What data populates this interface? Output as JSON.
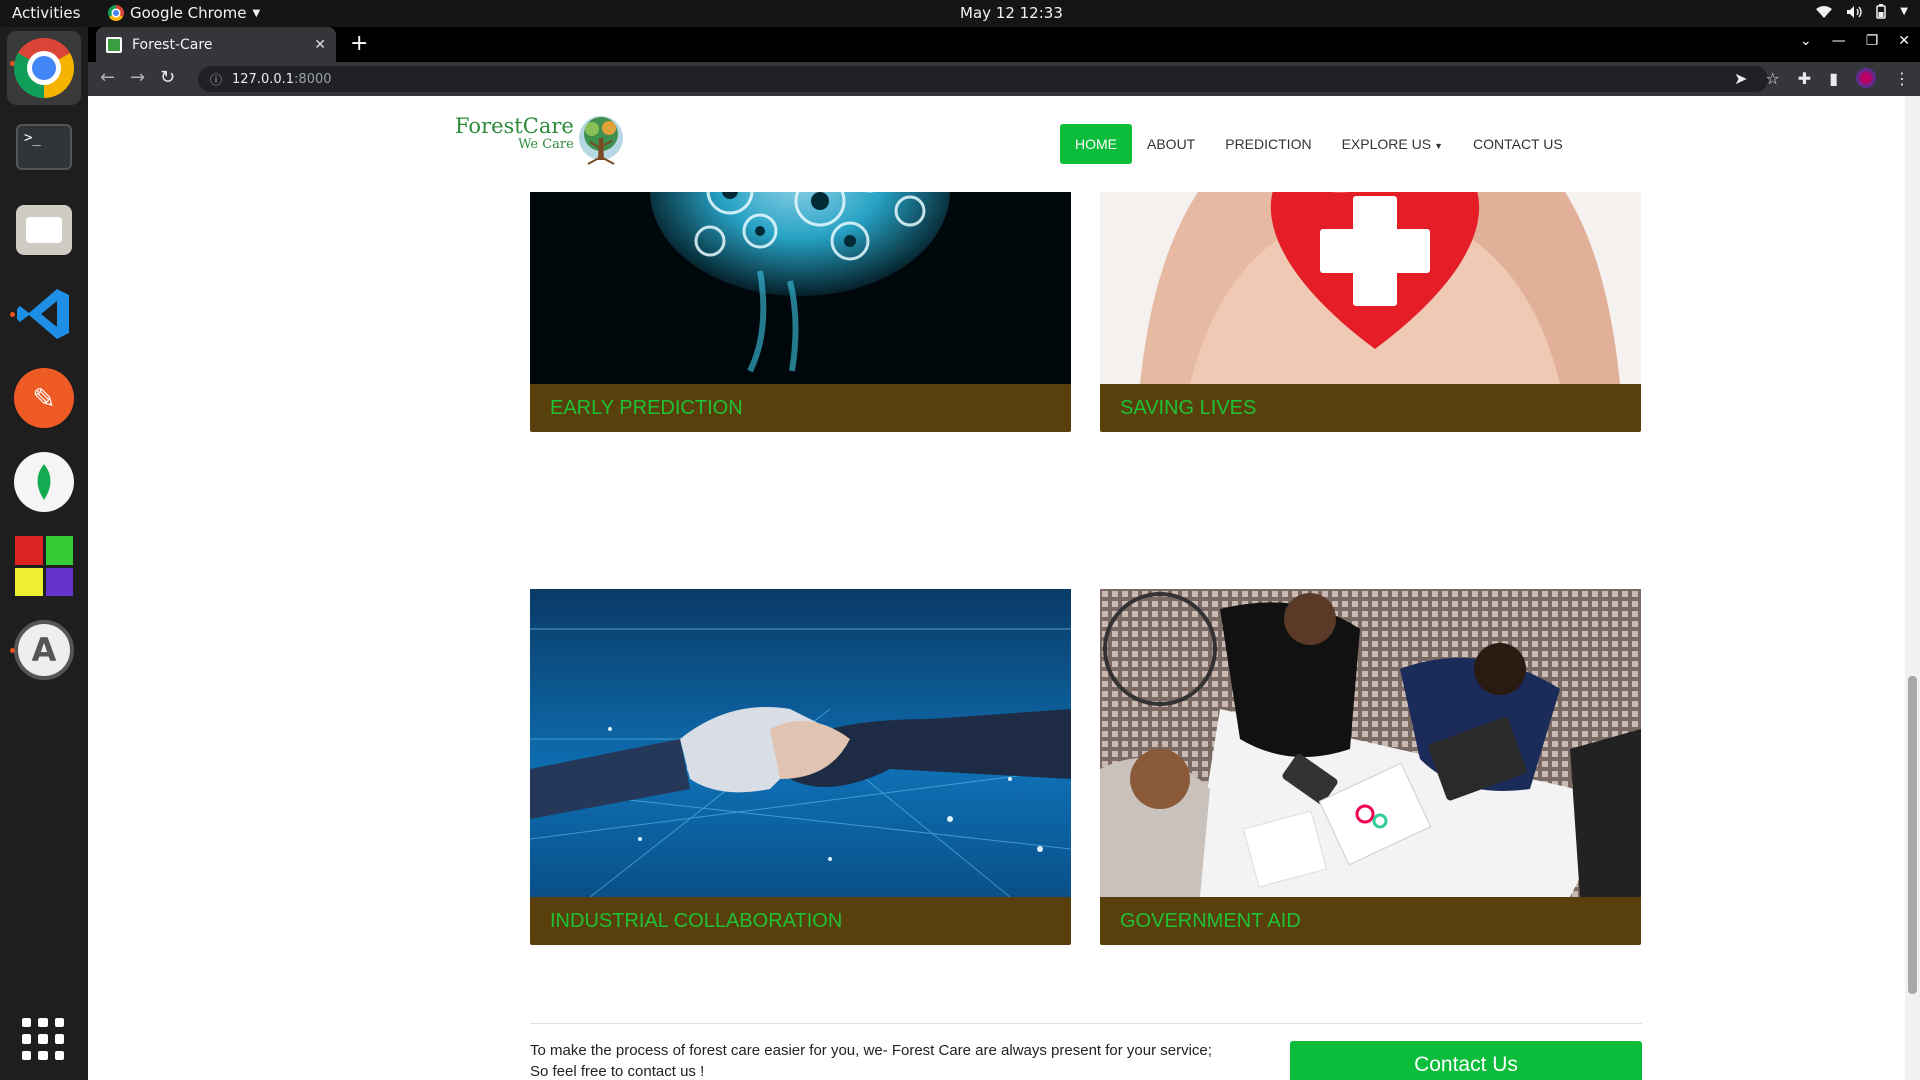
{
  "system_bar": {
    "activities_label": "Activities",
    "app_name": "Google Chrome",
    "clock": "May 12  12:33"
  },
  "browser": {
    "tab_title": "Forest-Care",
    "url_host": "127.0.0.1",
    "url_port": ":8000"
  },
  "site": {
    "logo": {
      "name": "ForestCare",
      "tagline": "We Care"
    },
    "nav": {
      "home": "HOME",
      "about": "ABOUT",
      "prediction": "PREDICTION",
      "explore": "EXPLORE US",
      "contact": "CONTACT US"
    },
    "cards": [
      {
        "title": "EARLY PREDICTION",
        "image": "glowing-brain-with-gears"
      },
      {
        "title": "SAVING LIVES",
        "image": "hands-holding-red-heart-with-cross"
      },
      {
        "title": "INDUSTRIAL COLLABORATION",
        "image": "digital-handshake"
      },
      {
        "title": "GOVERNMENT AID",
        "image": "business-team-meeting-at-table"
      }
    ],
    "cta": {
      "line1": "To make the process of forest care easier for you, we- Forest Care are always present for your service;",
      "line2": "So feel free to contact us !",
      "button": "Contact Us"
    }
  },
  "colors": {
    "accent_green": "#0bbd3a",
    "caption_bg": "#583f0c",
    "caption_text": "#1ec234"
  }
}
